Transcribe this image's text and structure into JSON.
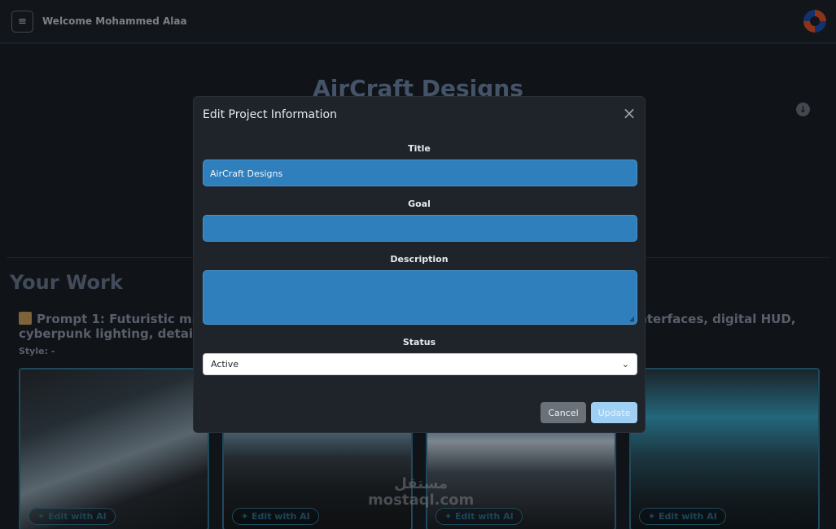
{
  "header": {
    "menu_icon": "hamburger-icon",
    "welcome": "Welcome Mohammed Alaa",
    "logo_icon": "swirl-logo"
  },
  "hero": {
    "title": "AirCraft Designs",
    "download_icon": "download-circle-icon"
  },
  "work": {
    "title": "Your Work",
    "prompt_visible_left": "Prompt 1: Futuristic mili",
    "prompt_visible_right": "g interfaces, digital HUD,",
    "prompt_line2": "cyberpunk lighting, detailed",
    "style_label": "Style:",
    "style_value": "-",
    "cards": [
      {
        "edit_label": "Edit with AI"
      },
      {
        "edit_label": "Edit with AI"
      },
      {
        "edit_label": "Edit with AI"
      },
      {
        "edit_label": "Edit with AI"
      }
    ],
    "watermark_ar": "مستقل",
    "watermark_en": "mostaql.com"
  },
  "modal": {
    "title": "Edit Project Information",
    "close_icon": "close-icon",
    "fields": {
      "title_label": "Title",
      "title_value": "AirCraft Designs",
      "goal_label": "Goal",
      "goal_value": "",
      "description_label": "Description",
      "description_value": "",
      "status_label": "Status",
      "status_value": "Active"
    },
    "buttons": {
      "cancel": "Cancel",
      "update": "Update"
    }
  }
}
